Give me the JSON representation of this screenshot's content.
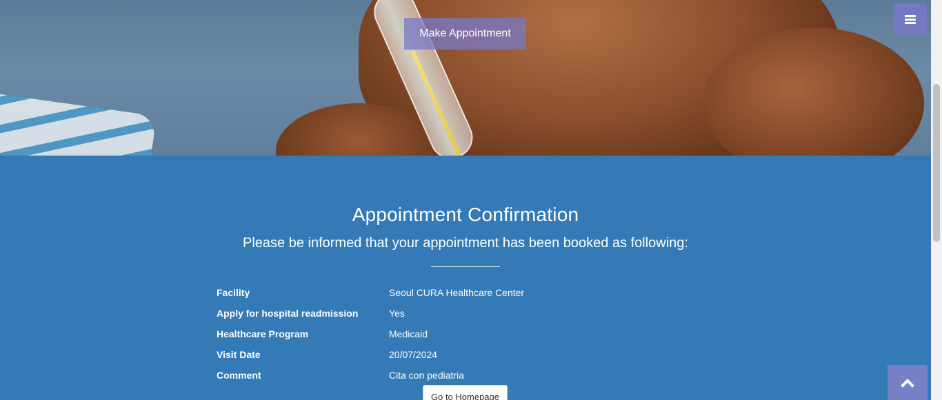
{
  "header": {
    "make_appointment_label": "Make Appointment",
    "menu_icon": "hamburger-menu-icon"
  },
  "confirmation": {
    "title": "Appointment Confirmation",
    "subtitle": "Please be informed that your appointment has been booked as following:",
    "fields": [
      {
        "label": "Facility",
        "value": "Seoul CURA Healthcare Center"
      },
      {
        "label": "Apply for hospital readmission",
        "value": "Yes"
      },
      {
        "label": "Healthcare Program",
        "value": "Medicaid"
      },
      {
        "label": "Visit Date",
        "value": "20/07/2024"
      },
      {
        "label": "Comment",
        "value": "Cita con pediatria"
      }
    ],
    "go_home_label": "Go to Homepage"
  },
  "colors": {
    "section_bg": "#337ab7",
    "accent_button": "#7878c8"
  },
  "icons": {
    "scroll_top": "chevron-up-icon"
  }
}
